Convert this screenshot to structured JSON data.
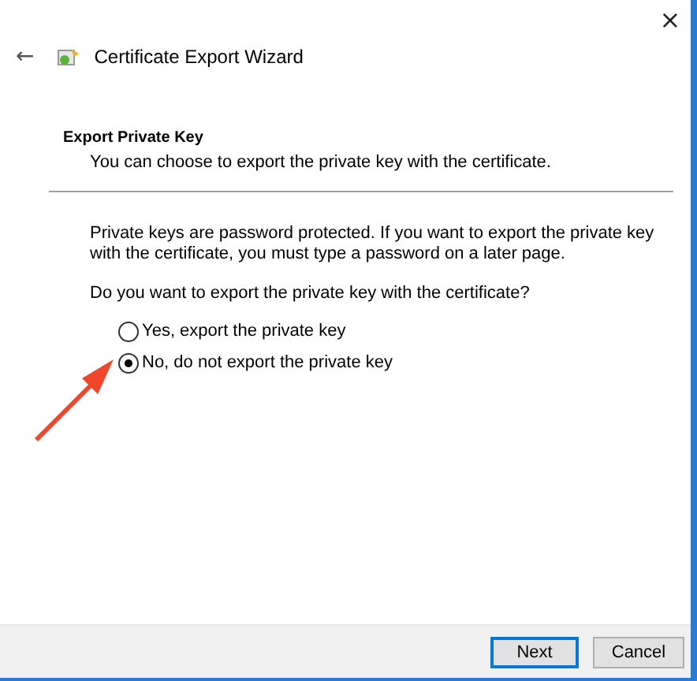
{
  "window": {
    "title": "Certificate Export Wizard",
    "close": "×",
    "back": "←"
  },
  "header": {
    "title": "Export Private Key",
    "subtitle": "You can choose to export the private key with the certificate."
  },
  "body": {
    "paragraph": "Private keys are password protected. If you want to export the private key with the certificate, you must type a password on a later page.",
    "question": "Do you want to export the private key with the certificate?"
  },
  "options": [
    {
      "label": "Yes, export the private key",
      "selected": false
    },
    {
      "label": "No, do not export the private key",
      "selected": true
    }
  ],
  "buttons": [
    {
      "label": "Next",
      "default": true
    },
    {
      "label": "Cancel",
      "default": false
    }
  ]
}
